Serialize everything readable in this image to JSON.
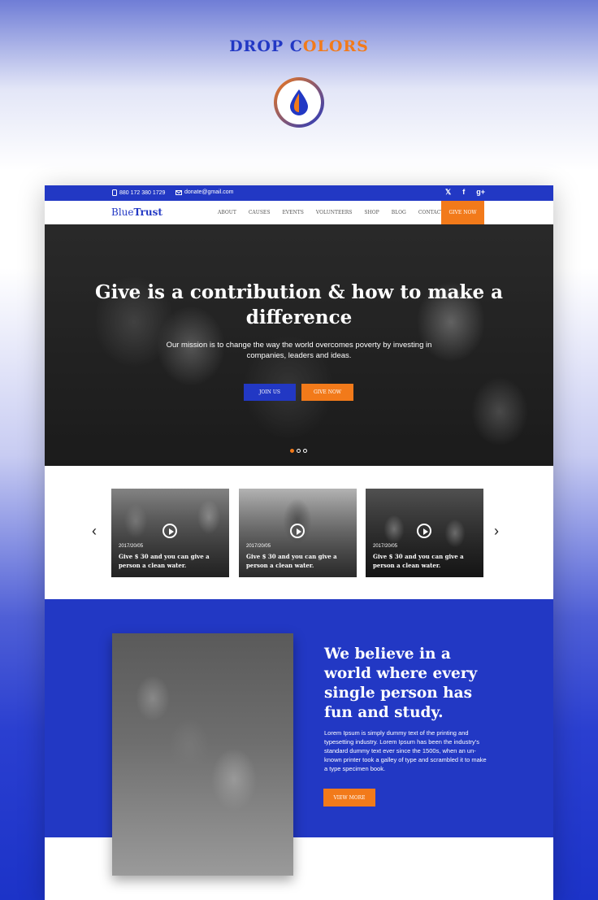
{
  "header": {
    "brand_part1": "DROP C",
    "brand_part2": "OLORS"
  },
  "topbar": {
    "phone": "880 172 380 1729",
    "email": "donate@gmail.com"
  },
  "nav": {
    "logo_regular": "Blue",
    "logo_bold": "Trust",
    "items": [
      "ABOUT",
      "CAUSES",
      "EVENTS",
      "VOLUNTEERS",
      "SHOP",
      "BLOG",
      "CONTACT"
    ],
    "give_now": "GIVE NOW"
  },
  "hero": {
    "title": "Give is a contribution & how to make a difference",
    "subtitle": "Our mission is to change the way the world overcomes poverty by investing in companies, leaders and ideas.",
    "join_us": "JOIN US",
    "give_now": "GIVE NOW",
    "slides": 3,
    "active_slide": 1
  },
  "videos": [
    {
      "date": "2017/20/05",
      "caption": "Give $ 30 and you can give a person a clean water."
    },
    {
      "date": "2017/20/05",
      "caption": "Give $ 30 and you can give a person a clean water."
    },
    {
      "date": "2017/20/05",
      "caption": "Give $ 30 and you can give a person a clean water."
    }
  ],
  "about": {
    "title": "We believe in a world where every single person has fun and study.",
    "body": "Lorem Ipsum is simply dummy text of the printing and typesetting industry. Lorem Ipsum has been the industry's standard dummy text ever since the 1500s, when an un-known printer took a galley of type and scrambled it to make a type specimen book.",
    "button": "VIEW MORE"
  },
  "colors": {
    "primary_blue": "#2238c4",
    "accent_orange": "#f27a1a"
  },
  "icons": [
    "water-drop-logo-icon",
    "phone-icon",
    "mail-icon",
    "twitter-icon",
    "facebook-icon",
    "google-plus-icon",
    "play-icon",
    "chevron-left-icon",
    "chevron-right-icon"
  ]
}
